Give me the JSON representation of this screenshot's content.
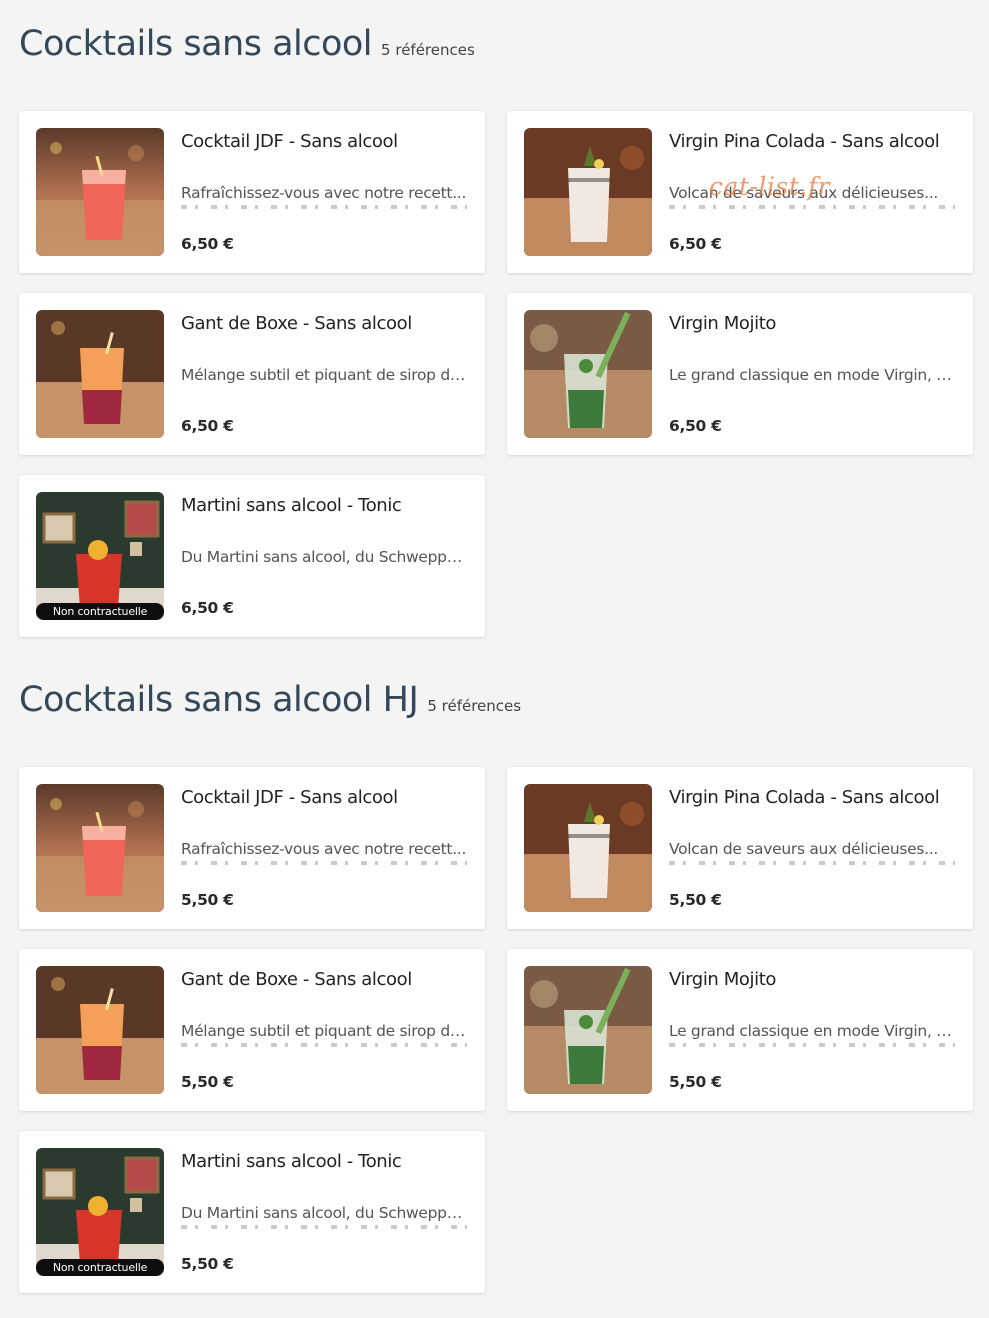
{
  "sections": [
    {
      "title": "Cocktails sans alcool",
      "count": "5 références",
      "items": [
        {
          "name": "Cocktail JDF - Sans alcool",
          "description": "Rafraîchissez-vous avec notre recett...",
          "price": "6,50 €",
          "image": "red-cocktail-photo"
        },
        {
          "name": "Virgin Pina Colada - Sans alcool",
          "description": "Volcan de saveurs aux délicieuses...",
          "price": "6,50 €",
          "image": "pina-colada-photo"
        },
        {
          "name": "Gant de Boxe - Sans alcool",
          "description": "Mélange subtil et piquant de sirop de...",
          "price": "6,50 €",
          "image": "orange-cocktail-photo"
        },
        {
          "name": "Virgin Mojito",
          "description": "Le grand classique en mode Virgin, à...",
          "price": "6,50 €",
          "image": "mojito-photo"
        },
        {
          "name": "Martini sans alcool - Tonic",
          "description": "Du Martini sans alcool, du Schweppe...",
          "price": "6,50 €",
          "image": "martini-tonic-photo",
          "badge": "Non contractuelle"
        }
      ]
    },
    {
      "title": "Cocktails sans alcool HJ",
      "count": "5 références",
      "items": [
        {
          "name": "Cocktail JDF - Sans alcool",
          "description": "Rafraîchissez-vous avec notre recett...",
          "price": "5,50 €",
          "image": "red-cocktail-photo"
        },
        {
          "name": "Virgin Pina Colada - Sans alcool",
          "description": "Volcan de saveurs aux délicieuses...",
          "price": "5,50 €",
          "image": "pina-colada-photo"
        },
        {
          "name": "Gant de Boxe - Sans alcool",
          "description": "Mélange subtil et piquant de sirop de...",
          "price": "5,50 €",
          "image": "orange-cocktail-photo"
        },
        {
          "name": "Virgin Mojito",
          "description": "Le grand classique en mode Virgin, à...",
          "price": "5,50 €",
          "image": "mojito-photo"
        },
        {
          "name": "Martini sans alcool - Tonic",
          "description": "Du Martini sans alcool, du Schweppe...",
          "price": "5,50 €",
          "image": "martini-tonic-photo",
          "badge": "Non contractuelle"
        }
      ]
    }
  ],
  "watermark": "cat-list.fr"
}
